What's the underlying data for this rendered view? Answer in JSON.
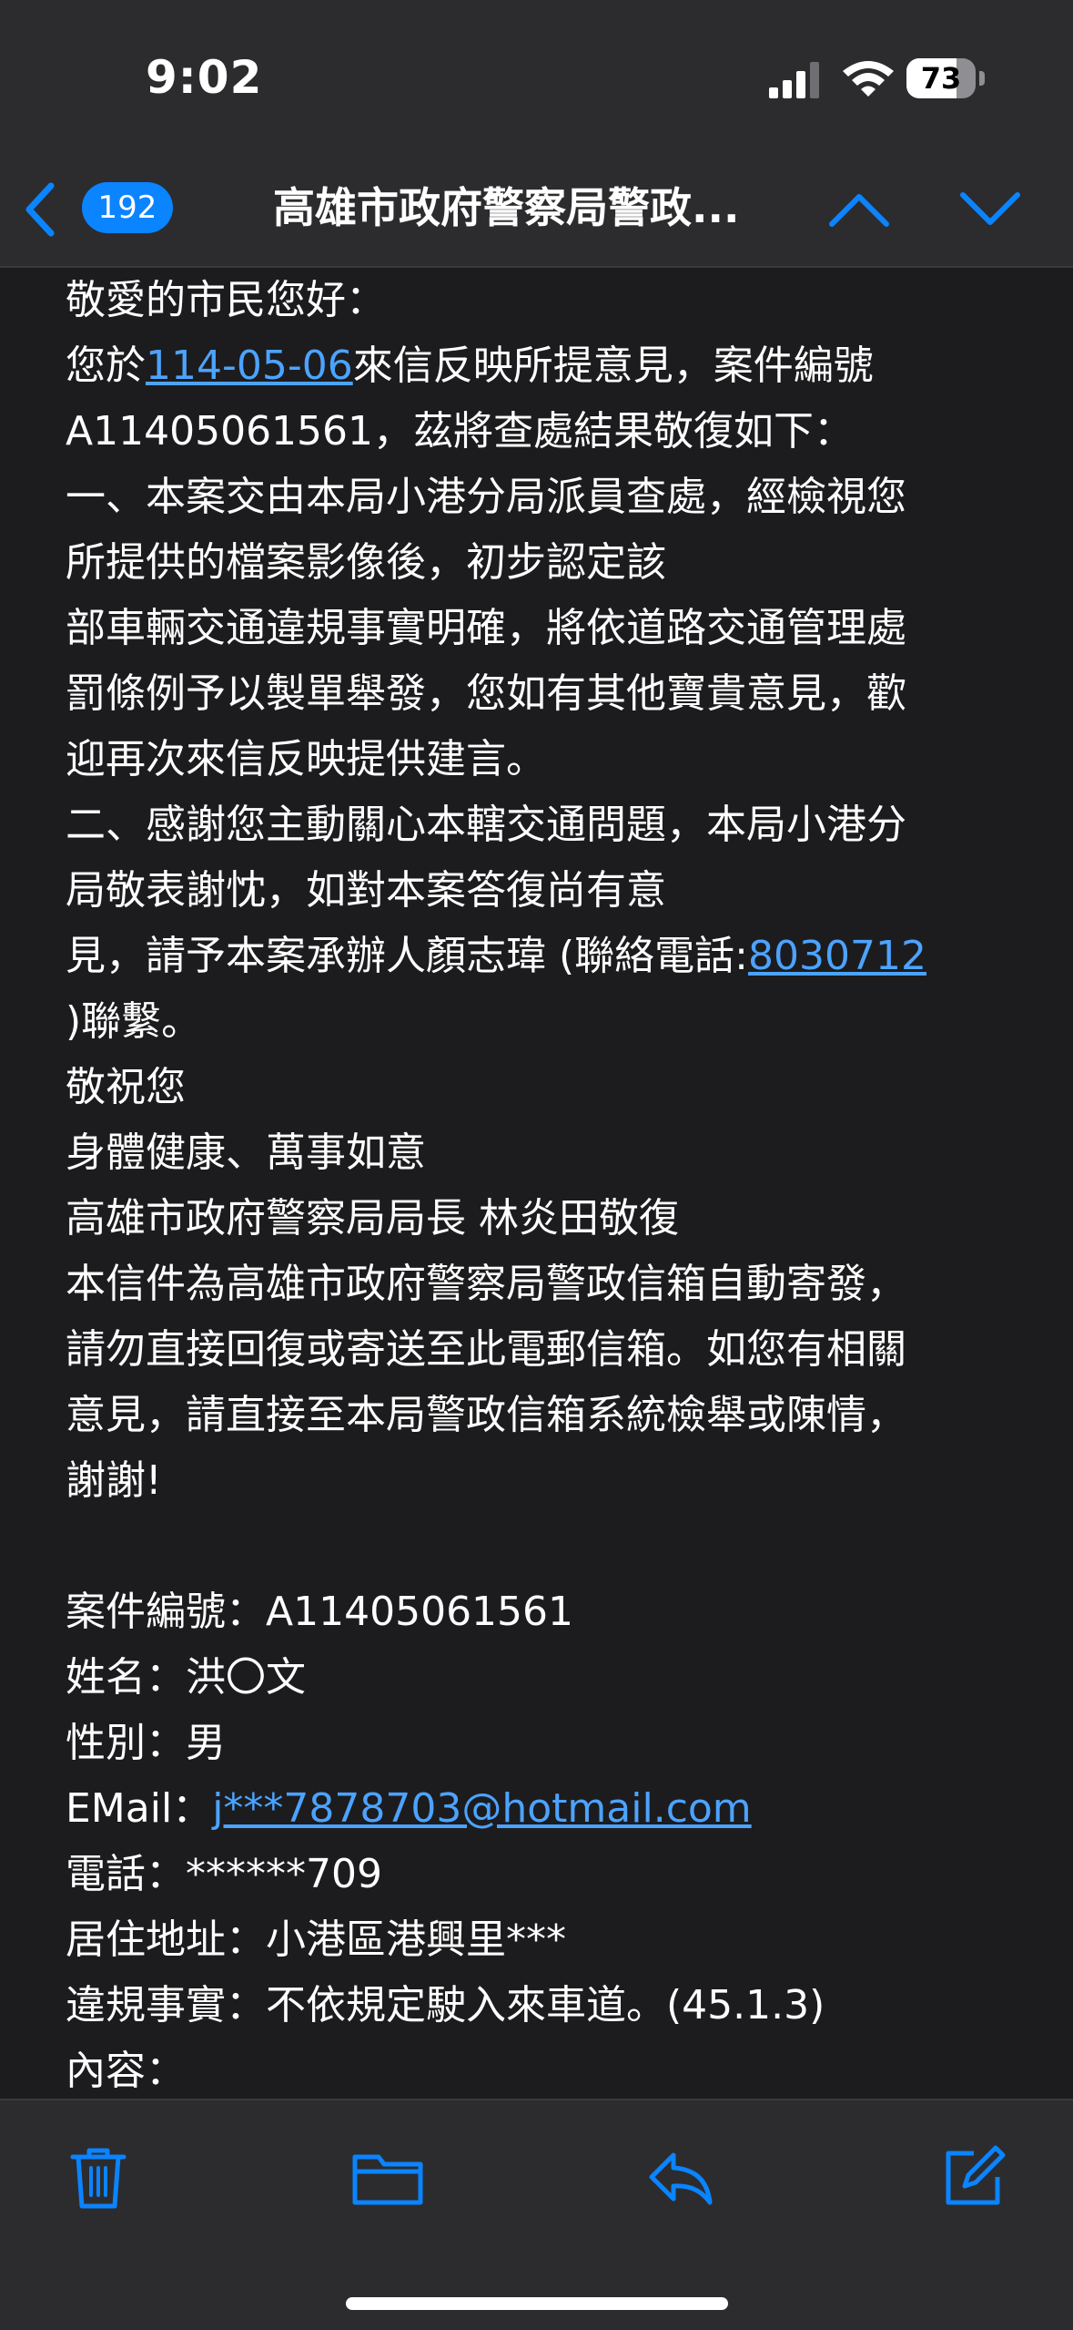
{
  "status_bar": {
    "time": "9:02",
    "battery": "73",
    "battery_level": 0.73
  },
  "nav": {
    "count": "192",
    "title": "高雄市政府警察局警政..."
  },
  "mail": {
    "greeting": "敬愛的市民您好：",
    "line2_prefix": "您於",
    "line2_date_link": "114-05-06",
    "line2_suffix": "來信反映所提意見，案件編號",
    "line3": "A11405061561，茲將查處結果敬復如下：",
    "line4": "一、本案交由本局小港分局派員查處，經檢視您",
    "line5": "所提供的檔案影像後，初步認定該",
    "line6": "部車輛交通違規事實明確，將依道路交通管理處",
    "line7": "罰條例予以製單舉發，您如有其他寶貴意見，歡",
    "line8": "迎再次來信反映提供建言。",
    "line9": "二、感謝您主動關心本轄交通問題，本局小港分",
    "line10": "局敬表謝忱，如對本案答復尚有意",
    "line11_prefix": "見，請予本案承辦人顏志瑋 (聯絡電話:",
    "line11_phone_link": "8030712",
    "line12": ")聯繫。",
    "line13": "敬祝您",
    "line14": "身體健康、萬事如意",
    "line15": "高雄市政府警察局局長 林炎田敬復",
    "line16": "本信件為高雄市政府警察局警政信箱自動寄發，",
    "line17": "請勿直接回復或寄送至此電郵信箱。如您有相關",
    "line18": "意見，請直接至本局警政信箱系統檢舉或陳情，",
    "line19": "謝謝!",
    "case_no": "案件編號：A11405061561",
    "name": "姓名：洪〇文",
    "gender": "性別：男",
    "email_label": "EMail：",
    "email_link": "j***7878703@hotmail.com",
    "phone": "電話：******709",
    "address": "居住地址：小港區港興里***",
    "violation": "違規事實：不依規定駛入來車道。(45.1.3)",
    "content_label": "內容："
  },
  "toolbar": {
    "icons": [
      "trash-icon",
      "folder-icon",
      "reply-icon",
      "compose-icon"
    ]
  },
  "colors": {
    "accent": "#0a84ff",
    "link": "#4ca3ff",
    "background": "#1c1c1e",
    "bar": "#2c2c2e"
  }
}
